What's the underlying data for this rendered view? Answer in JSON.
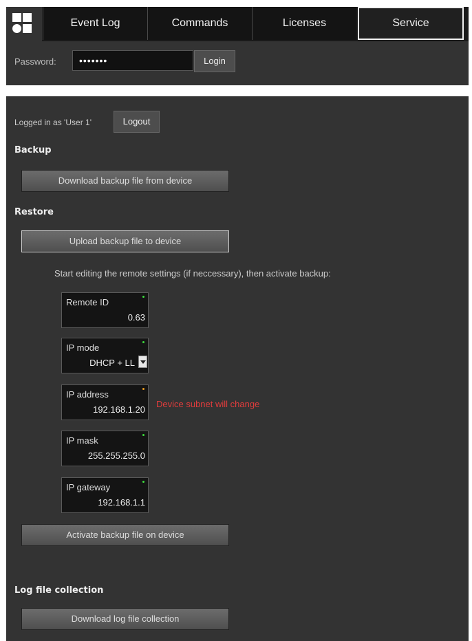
{
  "header": {
    "tabs": [
      {
        "label": "Event Log"
      },
      {
        "label": "Commands"
      },
      {
        "label": "Licenses"
      },
      {
        "label": "Service"
      }
    ],
    "active_tab": "Service",
    "password_label": "Password:",
    "password_value": "•••••••",
    "login_button": "Login"
  },
  "session": {
    "logged_in_text": "Logged in as 'User 1'",
    "logout_button": "Logout"
  },
  "backup": {
    "heading": "Backup",
    "download_button": "Download backup file from device"
  },
  "restore": {
    "heading": "Restore",
    "upload_button": "Upload backup file to device",
    "hint": "Start editing the remote settings (if neccessary), then activate backup:",
    "fields": [
      {
        "label": "Remote ID",
        "value": "0.63",
        "status_color": "#3ddc3d"
      },
      {
        "label": "IP mode",
        "value": "DHCP + LL",
        "status_color": "#3ddc3d"
      },
      {
        "label": "IP address",
        "value": "192.168.1.20",
        "status_color": "#f0a020"
      },
      {
        "label": "IP mask",
        "value": "255.255.255.0",
        "status_color": "#3ddc3d"
      },
      {
        "label": "IP gateway",
        "value": "192.168.1.1",
        "status_color": "#3ddc3d"
      }
    ],
    "warning": "Device subnet will change",
    "activate_button": "Activate backup file on device"
  },
  "logs": {
    "heading": "Log file collection",
    "download_button": "Download log file collection"
  },
  "colors": {
    "background": "#333333",
    "tab_bar": "#1a1a1a",
    "warning": "#e03c3c"
  }
}
